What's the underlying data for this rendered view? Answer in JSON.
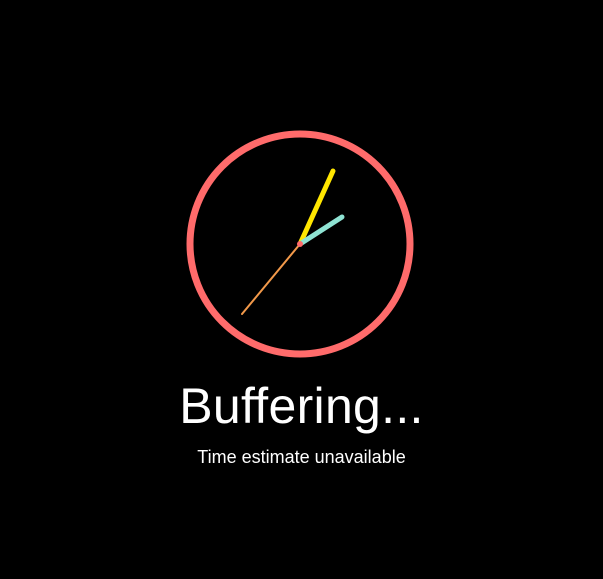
{
  "loading": {
    "title": "Buffering...",
    "subtitle": "Time estimate unavailable"
  },
  "clock": {
    "icon": "clock-icon",
    "colors": {
      "background": "#000000",
      "ring": "#ff6b6b",
      "hour_hand": "#8fe3d3",
      "minute_hand": "#ffe600",
      "second_hand": "#f2994a",
      "center_dot": "#ff6b6b"
    }
  }
}
